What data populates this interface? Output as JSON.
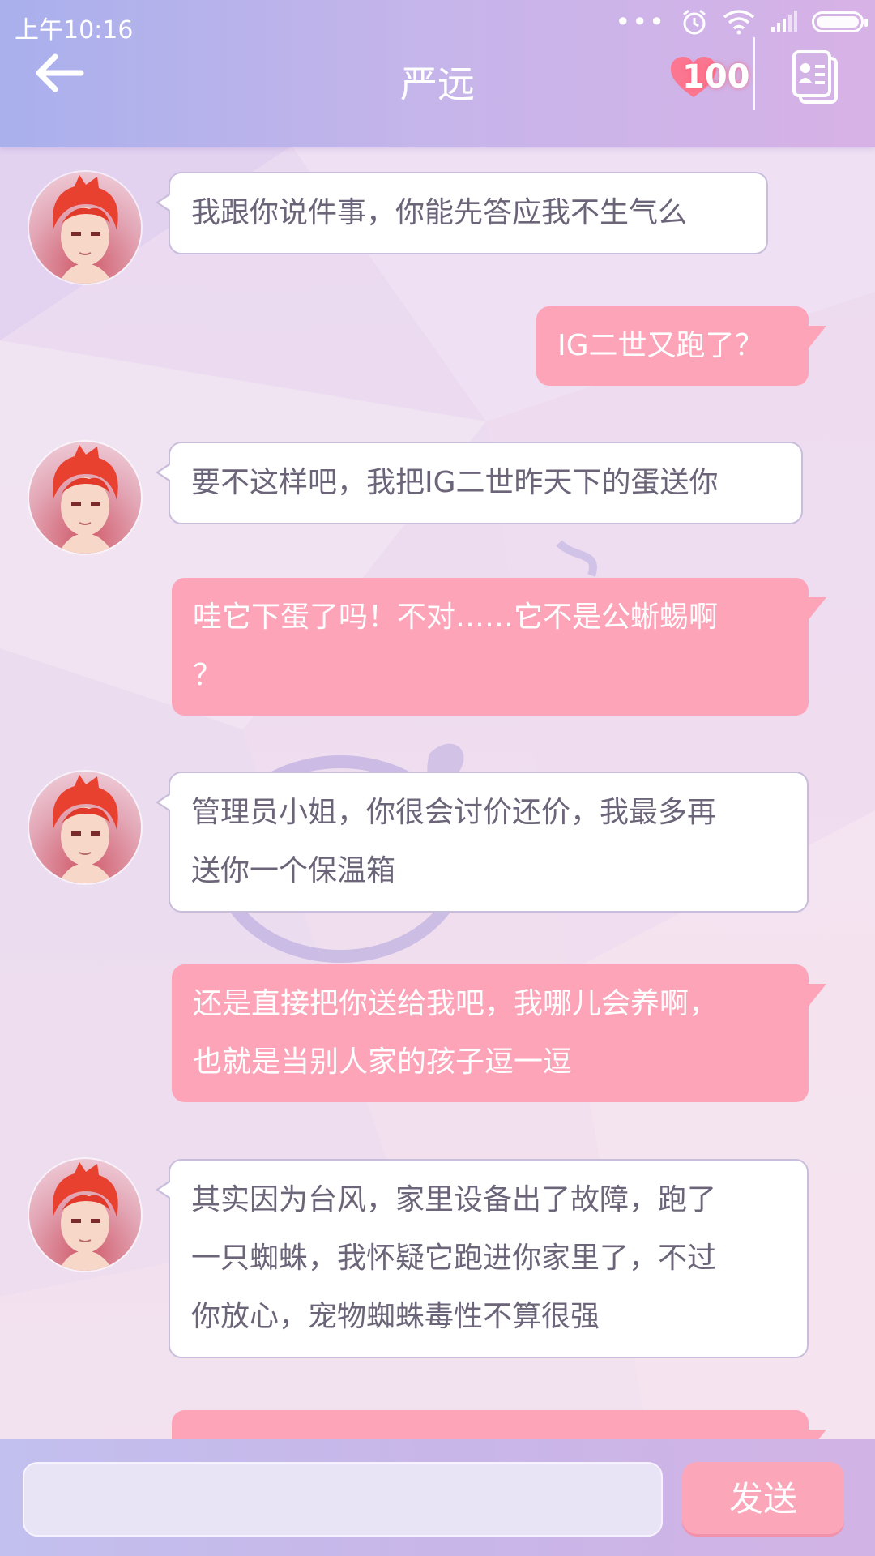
{
  "status_bar": {
    "time": "上午10:16",
    "dots": "•••"
  },
  "header": {
    "title": "严远",
    "affection_count": "100",
    "back_icon": "arrow-left-icon",
    "contact_icon": "contact-card-icon"
  },
  "messages": [
    {
      "side": "left",
      "lines": [
        "我跟你说件事，你能先答应我不生气么"
      ]
    },
    {
      "side": "right",
      "lines": [
        "IG二世又跑了？"
      ]
    },
    {
      "side": "left",
      "lines": [
        "要不这样吧，我把IG二世昨天下的蛋送你"
      ]
    },
    {
      "side": "right",
      "lines": [
        "哇它下蛋了吗！不对……它不是公蜥蜴啊",
        "？"
      ]
    },
    {
      "side": "left",
      "lines": [
        "管理员小姐，你很会讨价还价，我最多再",
        "送你一个保温箱"
      ]
    },
    {
      "side": "right",
      "lines": [
        "还是直接把你送给我吧，我哪儿会养啊，",
        "也就是当别人家的孩子逗一逗"
      ]
    },
    {
      "side": "left",
      "lines": [
        "其实因为台风，家里设备出了故障，跑了",
        "一只蜘蛛，我怀疑它跑进你家里了，不过",
        "你放心，宠物蜘蛛毒性不算很强"
      ]
    },
    {
      "side": "right",
      "lines": []
    }
  ],
  "composer": {
    "input_value": "",
    "send_label": "发送"
  },
  "colors": {
    "bubble_right": "#fda4b9",
    "bubble_left": "#ffffff",
    "header_start": "#a9b0ec",
    "header_end": "#d7b2e6"
  }
}
